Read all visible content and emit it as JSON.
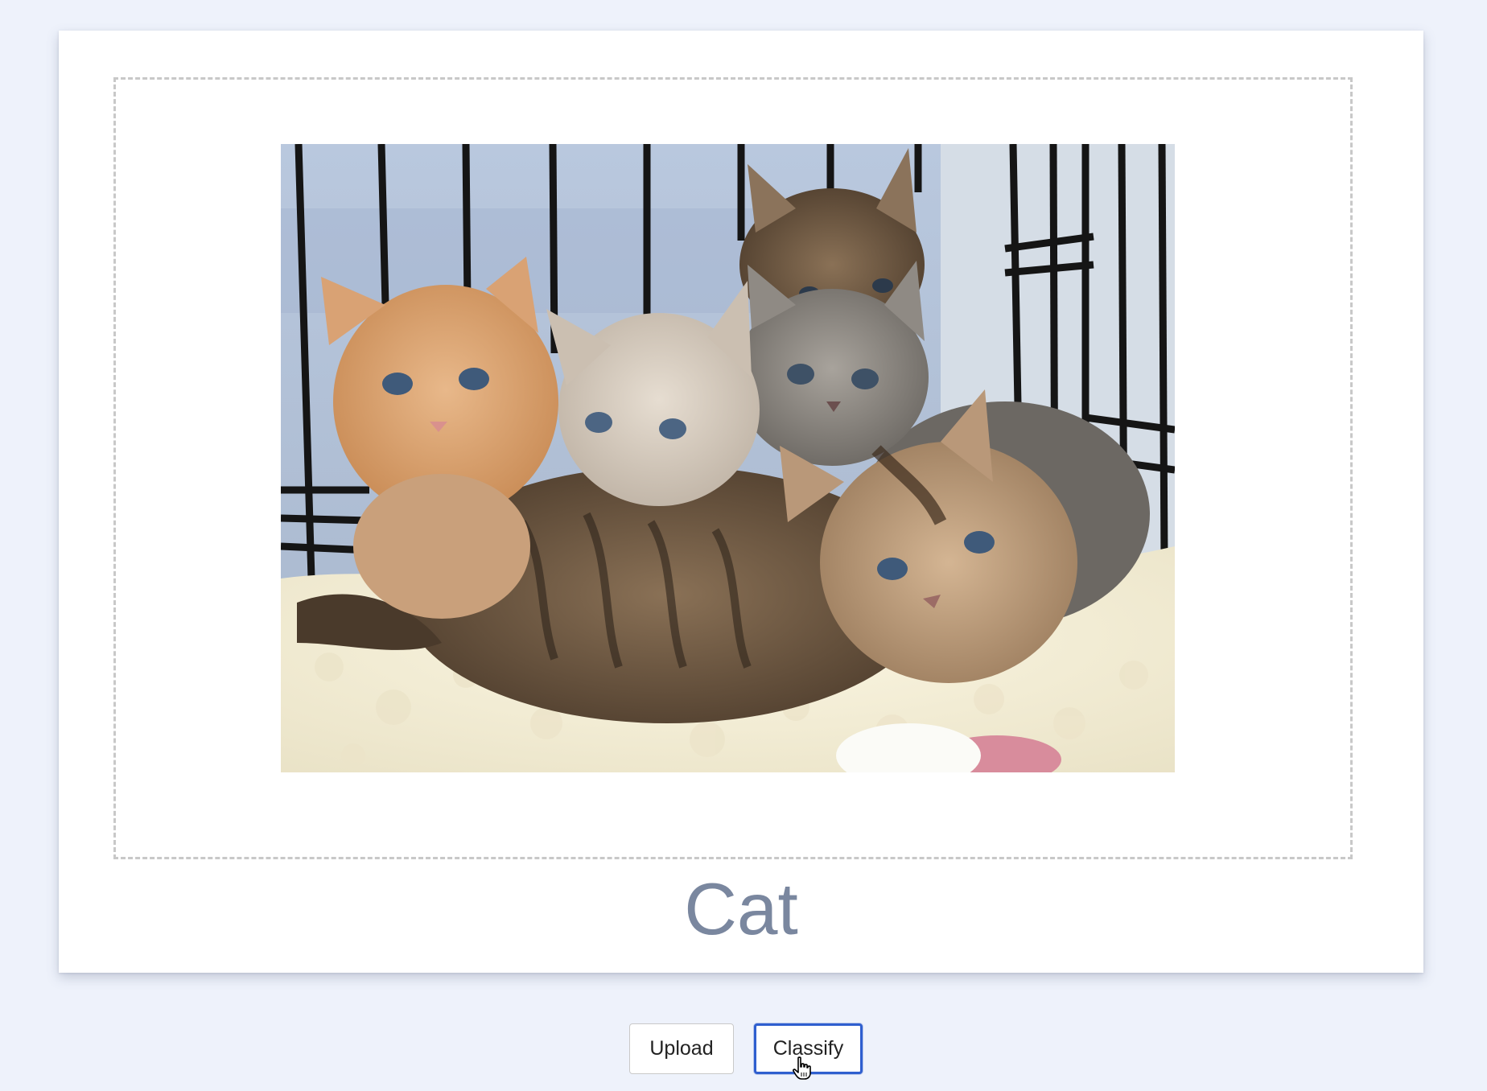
{
  "result": {
    "label": "Cat"
  },
  "image": {
    "alt": "Five kittens lying on a fleece blanket inside a wire crate",
    "icon": "photo-kittens"
  },
  "buttons": {
    "upload_label": "Upload",
    "classify_label": "Classify"
  },
  "colors": {
    "page_background": "#eef2fb",
    "card_background": "#ffffff",
    "result_text": "#7a879f",
    "focus_ring": "#2f5fcf",
    "dropzone_border": "#c8c8c8"
  },
  "cursor": {
    "icon": "hand-pointer-icon"
  }
}
